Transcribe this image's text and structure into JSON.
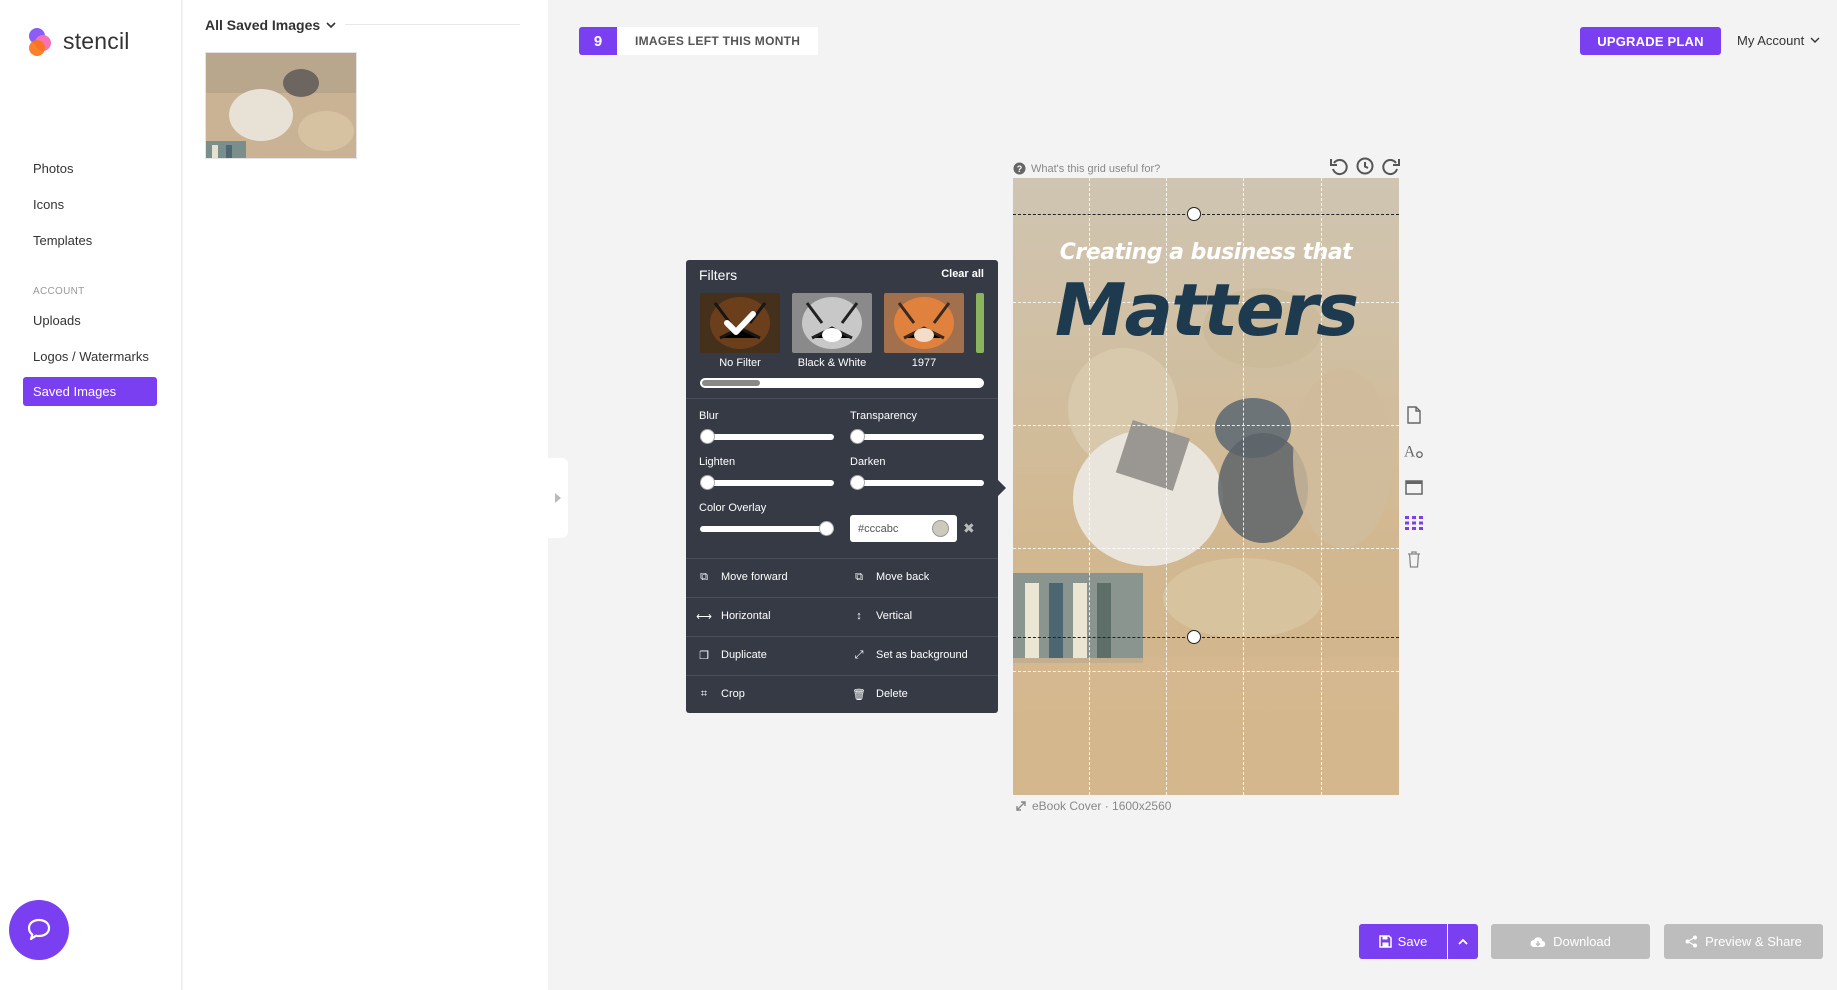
{
  "app": {
    "name": "stencil"
  },
  "nav": {
    "items": [
      {
        "label": "Photos"
      },
      {
        "label": "Icons"
      },
      {
        "label": "Templates"
      }
    ],
    "section_label": "ACCOUNT",
    "account_items": [
      {
        "label": "Uploads"
      },
      {
        "label": "Logos / Watermarks"
      },
      {
        "label": "Saved Images",
        "active": true
      }
    ]
  },
  "saved_panel": {
    "title": "All Saved Images"
  },
  "topbar": {
    "quota_count": "9",
    "quota_label": "IMAGES LEFT THIS MONTH",
    "upgrade_label": "UPGRADE PLAN",
    "account_label": "My Account"
  },
  "canvas": {
    "grid_help": "What's this grid useful for?",
    "headline_small": "Creating a business that",
    "headline_large": "Matters",
    "meta": "eBook Cover · 1600x2560"
  },
  "filters": {
    "title": "Filters",
    "clear_label": "Clear all",
    "swatches": [
      {
        "label": "No Filter",
        "selected": true
      },
      {
        "label": "Black & White"
      },
      {
        "label": "1977"
      }
    ],
    "sliders": {
      "blur": {
        "label": "Blur",
        "value": 0
      },
      "transparency": {
        "label": "Transparency",
        "value": 0
      },
      "lighten": {
        "label": "Lighten",
        "value": 0
      },
      "darken": {
        "label": "Darken",
        "value": 0
      },
      "color_overlay": {
        "label": "Color Overlay",
        "value": 1
      }
    },
    "overlay_color": "#cccabc",
    "actions": {
      "move_forward": "Move forward",
      "move_back": "Move back",
      "horizontal": "Horizontal",
      "vertical": "Vertical",
      "duplicate": "Duplicate",
      "set_background": "Set as background",
      "crop": "Crop",
      "delete": "Delete"
    }
  },
  "bottom": {
    "save_label": "Save",
    "download_label": "Download",
    "share_label": "Preview & Share"
  },
  "colors": {
    "accent": "#7b3ff2",
    "panel": "#353a45",
    "disabled": "#bdbdbd"
  }
}
